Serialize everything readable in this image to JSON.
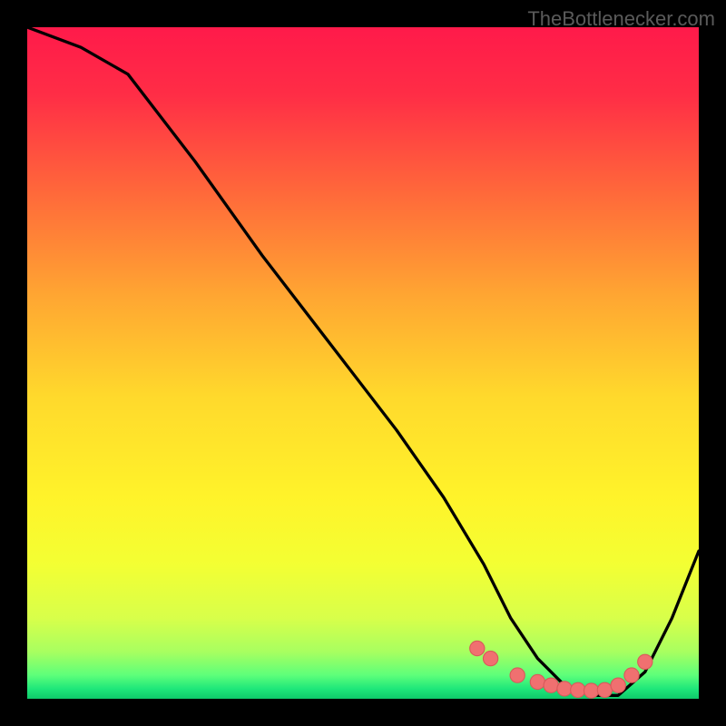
{
  "watermark": "TheBottlenecker.com",
  "chart_data": {
    "type": "line",
    "title": "",
    "xlabel": "",
    "ylabel": "",
    "xlim": [
      0,
      100
    ],
    "ylim": [
      0,
      100
    ],
    "series": [
      {
        "name": "bottleneck-curve",
        "x": [
          0,
          8,
          15,
          25,
          35,
          45,
          55,
          62,
          68,
          72,
          76,
          80,
          84,
          88,
          92,
          96,
          100
        ],
        "y": [
          100,
          97,
          93,
          80,
          66,
          53,
          40,
          30,
          20,
          12,
          6,
          2,
          0.5,
          0.5,
          4,
          12,
          22
        ]
      }
    ],
    "markers": {
      "name": "optimal-points",
      "x": [
        67,
        69,
        73,
        76,
        78,
        80,
        82,
        84,
        86,
        88,
        90,
        92
      ],
      "y": [
        7.5,
        6,
        3.5,
        2.5,
        2,
        1.5,
        1.3,
        1.2,
        1.3,
        2,
        3.5,
        5.5
      ]
    },
    "gradient_stops": [
      {
        "pos": 0.0,
        "color": "#ff1a4a"
      },
      {
        "pos": 0.1,
        "color": "#ff2d46"
      },
      {
        "pos": 0.25,
        "color": "#ff6a3a"
      },
      {
        "pos": 0.4,
        "color": "#ffa632"
      },
      {
        "pos": 0.55,
        "color": "#ffd92c"
      },
      {
        "pos": 0.7,
        "color": "#fff32a"
      },
      {
        "pos": 0.8,
        "color": "#f3ff33"
      },
      {
        "pos": 0.88,
        "color": "#d8ff4a"
      },
      {
        "pos": 0.93,
        "color": "#a8ff60"
      },
      {
        "pos": 0.965,
        "color": "#5dff7a"
      },
      {
        "pos": 0.985,
        "color": "#1fe77a"
      },
      {
        "pos": 1.0,
        "color": "#0fc96a"
      }
    ],
    "accent_colors": {
      "curve": "#000000",
      "marker_fill": "#f07070",
      "marker_stroke": "#d85a5a"
    }
  }
}
